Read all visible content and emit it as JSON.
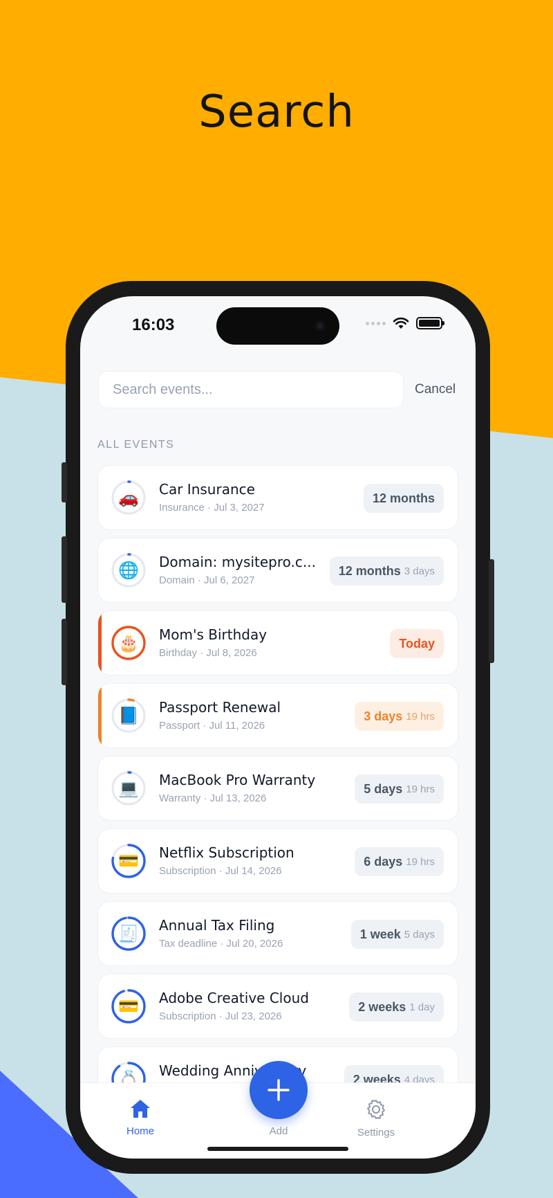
{
  "headline": "Search",
  "status_bar": {
    "time": "16:03"
  },
  "search": {
    "placeholder": "Search events...",
    "cancel_label": "Cancel"
  },
  "section_label": "ALL EVENTS",
  "events": [
    {
      "emoji": "🚗",
      "title": "Car Insurance",
      "subtitle": "Insurance · Jul 3, 2027",
      "badge_main": "12 months",
      "badge_minor": "",
      "tone": "neutral",
      "accent": "",
      "progress": 0.01
    },
    {
      "emoji": "🌐",
      "title": "Domain: mysitepro.c...",
      "subtitle": "Domain · Jul 6, 2027",
      "badge_main": "12 months",
      "badge_minor": "3 days",
      "tone": "neutral",
      "accent": "",
      "progress": 0.01
    },
    {
      "emoji": "🎂",
      "title": "Mom's Birthday",
      "subtitle": "Birthday · Jul 8, 2026",
      "badge_main": "Today",
      "badge_minor": "",
      "tone": "red",
      "accent": "#e8541e",
      "progress": 1.0
    },
    {
      "emoji": "📘",
      "title": "Passport Renewal",
      "subtitle": "Passport · Jul 11, 2026",
      "badge_main": "3 days",
      "badge_minor": "19 hrs",
      "tone": "orange",
      "accent": "#f0822a",
      "progress": 0.05
    },
    {
      "emoji": "💻",
      "title": "MacBook Pro Warranty",
      "subtitle": "Warranty · Jul 13, 2026",
      "badge_main": "5 days",
      "badge_minor": "19 hrs",
      "tone": "neutral",
      "accent": "",
      "progress": 0.02
    },
    {
      "emoji": "💳",
      "title": "Netflix Subscription",
      "subtitle": "Subscription · Jul 14, 2026",
      "badge_main": "6 days",
      "badge_minor": "19 hrs",
      "tone": "neutral",
      "accent": "",
      "progress": 0.78
    },
    {
      "emoji": "🧾",
      "title": "Annual Tax Filing",
      "subtitle": "Tax deadline · Jul 20, 2026",
      "badge_main": "1 week",
      "badge_minor": "5 days",
      "tone": "neutral",
      "accent": "",
      "progress": 0.97
    },
    {
      "emoji": "💳",
      "title": "Adobe Creative Cloud",
      "subtitle": "Subscription · Jul 23, 2026",
      "badge_main": "2 weeks",
      "badge_minor": "1 day",
      "tone": "neutral",
      "accent": "",
      "progress": 0.95
    },
    {
      "emoji": "💍",
      "title": "Wedding Anniversary",
      "subtitle": "",
      "badge_main": "2 weeks",
      "badge_minor": "4 days",
      "tone": "neutral",
      "accent": "",
      "progress": 0.9
    }
  ],
  "tabbar": {
    "home_label": "Home",
    "add_label": "Add",
    "settings_label": "Settings"
  },
  "colors": {
    "background_orange": "#ffad00",
    "background_teal": "#c8e1e8",
    "background_blue": "#4a6dff",
    "primary": "#2d63e4",
    "today_red": "#e8541e",
    "soon_orange": "#f0822a"
  }
}
